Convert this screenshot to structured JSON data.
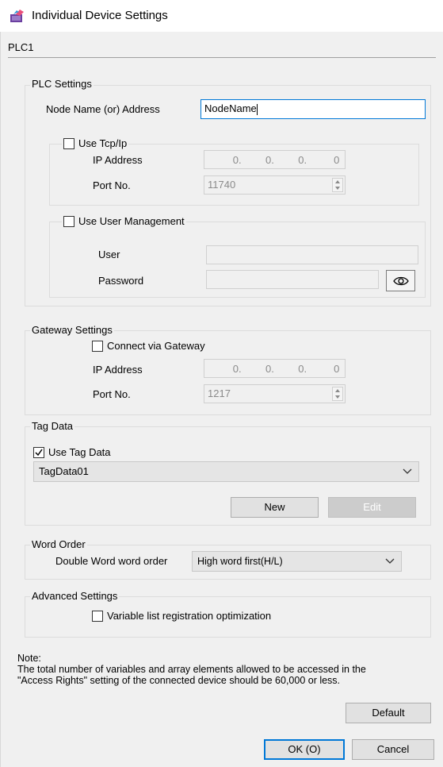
{
  "window": {
    "title": "Individual Device Settings",
    "tab": "PLC1"
  },
  "plc_settings": {
    "legend": "PLC Settings",
    "node_label": "Node Name (or) Address",
    "node_value": "NodeName",
    "tcp": {
      "checkbox_label": "Use Tcp/Ip",
      "checked": false,
      "ip_label": "IP Address",
      "ip": [
        "0.",
        "0.",
        "0.",
        "0"
      ],
      "port_label": "Port No.",
      "port_value": "11740"
    },
    "user_mgmt": {
      "checkbox_label": "Use User Management",
      "checked": false,
      "user_label": "User",
      "user_value": "",
      "password_label": "Password",
      "password_value": ""
    }
  },
  "gateway": {
    "legend": "Gateway Settings",
    "checkbox_label": "Connect via Gateway",
    "checked": false,
    "ip_label": "IP Address",
    "ip": [
      "0.",
      "0.",
      "0.",
      "0"
    ],
    "port_label": "Port No.",
    "port_value": "1217"
  },
  "tag_data": {
    "legend": "Tag Data",
    "checkbox_label": "Use Tag Data",
    "checked": true,
    "selected": "TagData01",
    "new_label": "New",
    "edit_label": "Edit"
  },
  "word_order": {
    "legend": "Word Order",
    "label": "Double Word word order",
    "selected": "High word first(H/L)"
  },
  "advanced": {
    "legend": "Advanced Settings",
    "checkbox_label": "Variable list registration optimization",
    "checked": false
  },
  "note": {
    "title": "Note:",
    "line1": "The total number of variables and array elements allowed to be accessed in the",
    "line2": "\"Access Rights\" setting of the connected device should be 60,000 or less."
  },
  "buttons": {
    "default": "Default",
    "ok": "OK (O)",
    "cancel": "Cancel"
  },
  "colors": {
    "accent": "#0078d7",
    "client_bg": "#f0f0f0"
  }
}
